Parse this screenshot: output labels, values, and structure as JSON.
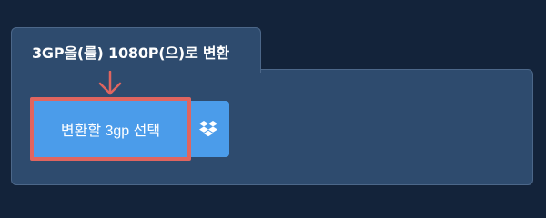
{
  "converter": {
    "tab_title": "3GP을(를) 1080P(으)로 변환",
    "select_button_label": "변환할 3gp 선택",
    "dropbox_icon": "dropbox-icon"
  },
  "colors": {
    "page_background": "#13233a",
    "panel_background": "#2e4b6e",
    "button_blue": "#4b9cea",
    "highlight_red": "#e0655f"
  }
}
